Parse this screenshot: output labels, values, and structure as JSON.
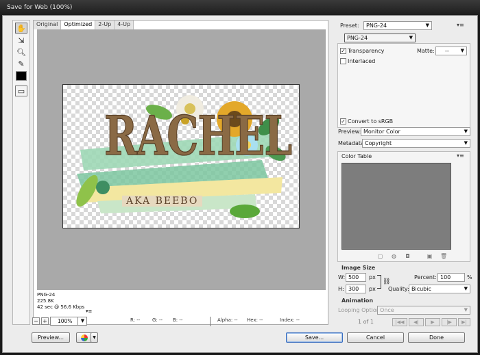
{
  "window": {
    "title": "Save for Web (100%)"
  },
  "tabs": [
    "Original",
    "Optimized",
    "2-Up",
    "4-Up"
  ],
  "image": {
    "main_text": "RACHEL",
    "subtitle": "AKA BEEBO"
  },
  "file_info": {
    "format": "PNG-24",
    "size": "225.8K",
    "time": "42 sec @ 56.6 Kbps",
    "menu": "▾≡"
  },
  "status": {
    "zoom": "100%",
    "r": "R: --",
    "g": "G: --",
    "b": "B: --",
    "alpha": "Alpha: --",
    "hex": "Hex: --",
    "index": "Index: --"
  },
  "buttons": {
    "preview": "Preview...",
    "save": "Save...",
    "cancel": "Cancel",
    "done": "Done"
  },
  "settings": {
    "preset_label": "Preset:",
    "preset_value": "PNG-24",
    "format_value": "PNG-24",
    "transparency": "Transparency",
    "matte_label": "Matte:",
    "matte_value": "--",
    "interlaced": "Interlaced",
    "convert_srgb": "Convert to sRGB",
    "preview_label": "Preview:",
    "preview_value": "Monitor Color",
    "metadata_label": "Metadata:",
    "metadata_value": "Copyright",
    "color_table": "Color Table"
  },
  "image_size": {
    "title": "Image Size",
    "w_label": "W:",
    "w_value": "500",
    "h_label": "H:",
    "h_value": "300",
    "unit": "px",
    "percent_label": "Percent:",
    "percent_value": "100",
    "percent_unit": "%",
    "quality_label": "Quality:",
    "quality_value": "Bicubic"
  },
  "animation": {
    "title": "Animation",
    "looping_label": "Looping Options:",
    "looping_value": "Once",
    "frame": "1 of 1"
  }
}
